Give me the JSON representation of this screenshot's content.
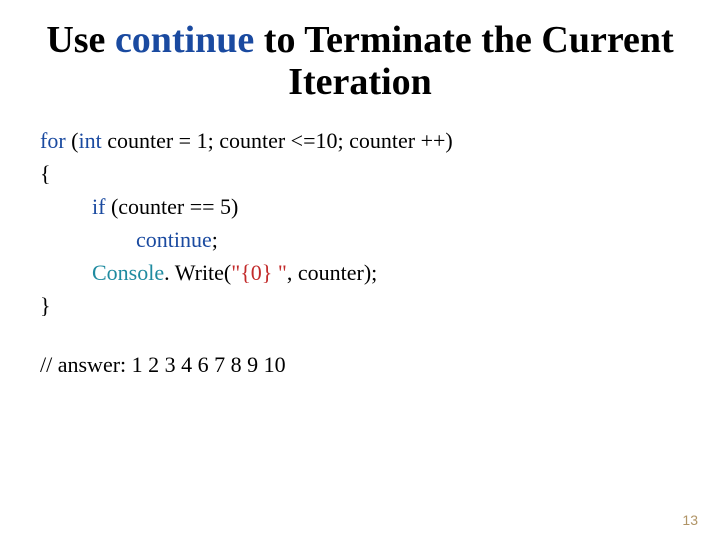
{
  "title": {
    "before": "Use ",
    "keyword": "continue",
    "after": " to Terminate the Current Iteration"
  },
  "code": {
    "for_kw": "for",
    "int_kw": "int",
    "for_rest": " counter = 1; counter <=10; counter ++)",
    "open_brace": "{",
    "if_kw": "if",
    "if_rest": " (counter == 5)",
    "continue_kw": "continue",
    "continue_semi": ";",
    "console": "Console",
    "write_open": ". Write(",
    "str_lit": "\"{0}  \"",
    "write_close": ", counter);",
    "close_brace": "}"
  },
  "answer_line": "// answer: 1 2 3 4 6 7 8 9 10",
  "pagenum": "13"
}
